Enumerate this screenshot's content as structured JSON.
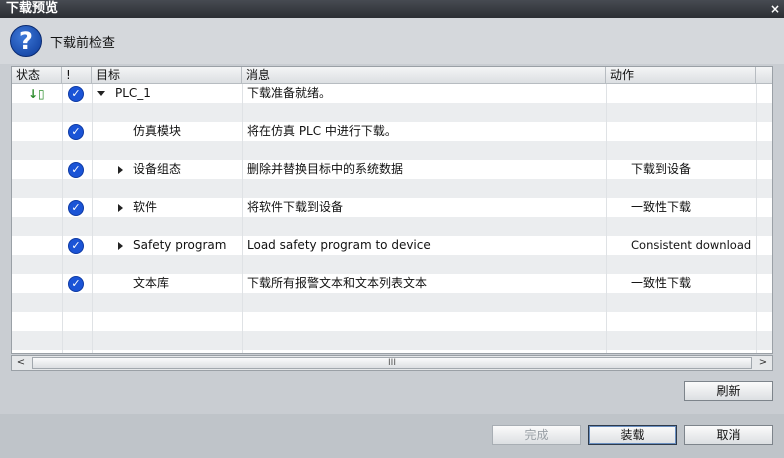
{
  "window": {
    "title": "下载预览",
    "close": "×"
  },
  "header": {
    "icon": "question-icon",
    "title": "下载前检查"
  },
  "columns": {
    "status": "状态",
    "bang": "!",
    "target": "目标",
    "message": "消息",
    "action": "动作"
  },
  "rows": [
    {
      "status_icon": "download-arrow-icon",
      "check": "✓",
      "expand": "down",
      "target": "PLC_1",
      "message": "下载准备就绪。",
      "action": ""
    },
    {
      "check": "✓",
      "expand": "",
      "target": "仿真模块",
      "message": "将在仿真 PLC 中进行下载。",
      "action": ""
    },
    {
      "check": "✓",
      "expand": "right",
      "target": "设备组态",
      "message": "删除并替换目标中的系统数据",
      "action": "下载到设备"
    },
    {
      "check": "✓",
      "expand": "right",
      "target": "软件",
      "message": "将软件下载到设备",
      "action": "一致性下载"
    },
    {
      "check": "✓",
      "expand": "right",
      "target": "Safety program",
      "message": "Load safety program to device",
      "action": "Consistent download"
    },
    {
      "check": "✓",
      "expand": "",
      "target": "文本库",
      "message": "下载所有报警文本和文本列表文本",
      "action": "一致性下载"
    }
  ],
  "scrollbar": {
    "left": "<",
    "right": ">",
    "thumb": "III"
  },
  "buttons": {
    "refresh": "刷新",
    "finish": "完成",
    "load": "装载",
    "cancel": "取消"
  }
}
